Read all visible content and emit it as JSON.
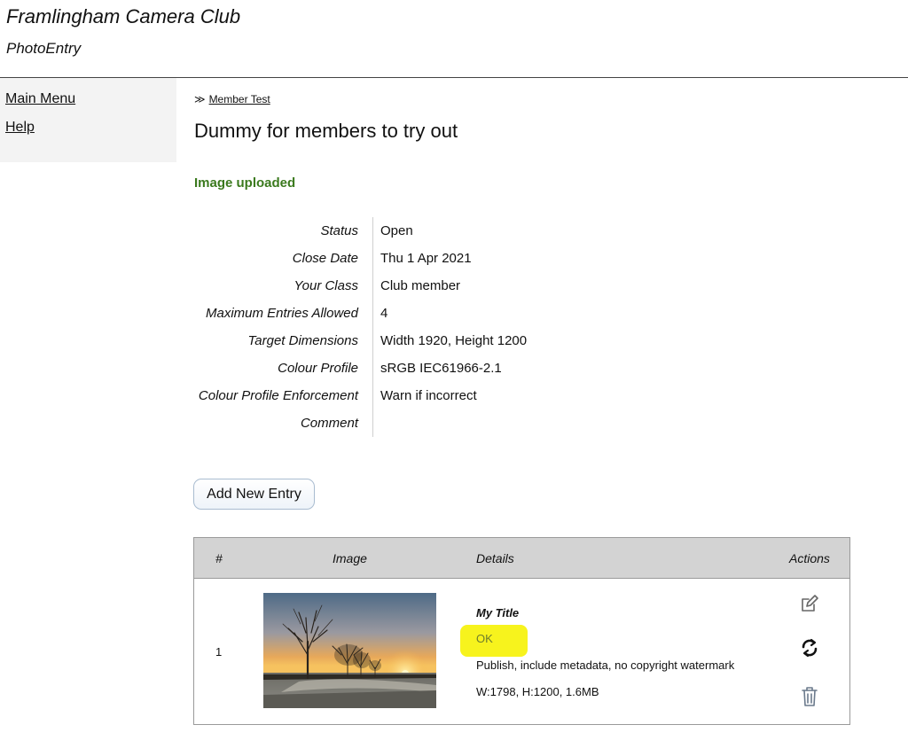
{
  "header": {
    "site_title": "Framlingham Camera Club",
    "site_subtitle": "PhotoEntry"
  },
  "sidebar": {
    "items": [
      {
        "label": "Main Menu"
      },
      {
        "label": "Help"
      }
    ]
  },
  "breadcrumb": {
    "separator": "≫",
    "link": "Member Test"
  },
  "page_title": "Dummy for members to try out",
  "upload_message": "Image uploaded",
  "info": {
    "rows": [
      {
        "label": "Status",
        "value": "Open"
      },
      {
        "label": "Close Date",
        "value": "Thu 1 Apr 2021"
      },
      {
        "label": "Your Class",
        "value": "Club member"
      },
      {
        "label": "Maximum Entries Allowed",
        "value": "4"
      },
      {
        "label": "Target Dimensions",
        "value": "Width 1920, Height 1200"
      },
      {
        "label": "Colour Profile",
        "value": "sRGB IEC61966-2.1"
      },
      {
        "label": "Colour Profile Enforcement",
        "value": "Warn if incorrect"
      },
      {
        "label": "Comment",
        "value": ""
      }
    ]
  },
  "add_button_label": "Add New Entry",
  "entries": {
    "headers": {
      "number": "#",
      "image": "Image",
      "details": "Details",
      "actions": "Actions"
    },
    "rows": [
      {
        "number": "1",
        "title": "My Title",
        "status": "OK",
        "publish": "Publish, include metadata, no copyright watermark",
        "dimensions": "W:1798, H:1200, 1.6MB"
      }
    ]
  },
  "icons": {
    "edit": "edit-icon",
    "replace": "refresh-icon",
    "delete": "trash-icon"
  },
  "colors": {
    "success": "#3b7a1e",
    "highlight": "#f7f31d",
    "table_header": "#d3d3d3"
  }
}
